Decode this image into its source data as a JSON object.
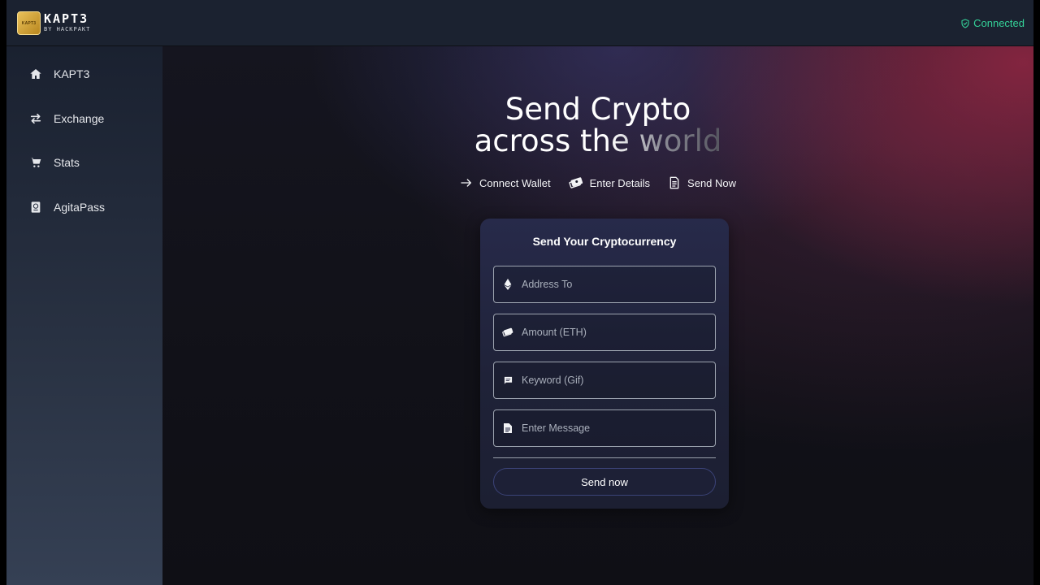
{
  "header": {
    "logo_badge_text": "KAPT3",
    "logo_title": "KAPT3",
    "logo_subtitle": "BY HACKPAKT",
    "status": {
      "label": "Connected",
      "icon": "shield-check-icon",
      "color": "#34d399"
    }
  },
  "sidebar": {
    "items": [
      {
        "label": "KAPT3",
        "icon": "home-icon"
      },
      {
        "label": "Exchange",
        "icon": "exchange-arrows-icon"
      },
      {
        "label": "Stats",
        "icon": "cart-icon"
      },
      {
        "label": "AgitaPass",
        "icon": "passport-icon"
      }
    ]
  },
  "hero": {
    "line1": "Send Crypto",
    "line2": "across the world"
  },
  "steps": [
    {
      "label": "Connect Wallet",
      "icon": "arrow-right-icon"
    },
    {
      "label": "Enter Details",
      "icon": "money-icon"
    },
    {
      "label": "Send Now",
      "icon": "document-icon"
    }
  ],
  "form": {
    "title": "Send Your Cryptocurrency",
    "fields": [
      {
        "placeholder": "Address To",
        "value": "",
        "icon": "ethereum-icon"
      },
      {
        "placeholder": "Amount (ETH)",
        "value": "",
        "icon": "money-icon"
      },
      {
        "placeholder": "Keyword (Gif)",
        "value": "",
        "icon": "chat-icon"
      },
      {
        "placeholder": "Enter Message",
        "value": "",
        "icon": "note-icon"
      }
    ],
    "submit_label": "Send now"
  }
}
